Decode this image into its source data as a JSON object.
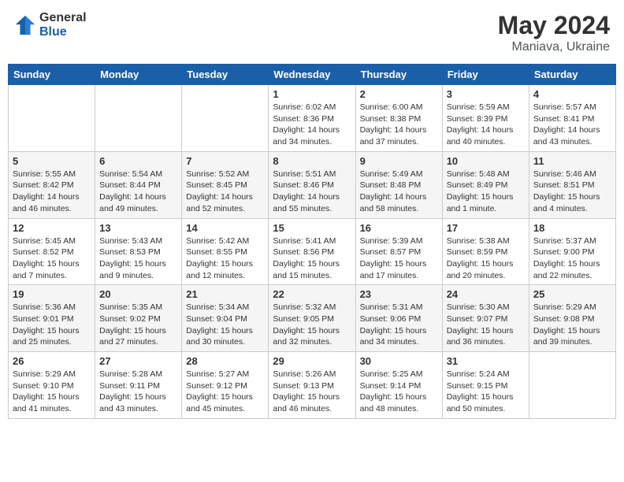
{
  "header": {
    "logo_general": "General",
    "logo_blue": "Blue",
    "month_year": "May 2024",
    "location": "Maniava, Ukraine"
  },
  "weekdays": [
    "Sunday",
    "Monday",
    "Tuesday",
    "Wednesday",
    "Thursday",
    "Friday",
    "Saturday"
  ],
  "weeks": [
    [
      {
        "day": "",
        "info": ""
      },
      {
        "day": "",
        "info": ""
      },
      {
        "day": "",
        "info": ""
      },
      {
        "day": "1",
        "info": "Sunrise: 6:02 AM\nSunset: 8:36 PM\nDaylight: 14 hours\nand 34 minutes."
      },
      {
        "day": "2",
        "info": "Sunrise: 6:00 AM\nSunset: 8:38 PM\nDaylight: 14 hours\nand 37 minutes."
      },
      {
        "day": "3",
        "info": "Sunrise: 5:59 AM\nSunset: 8:39 PM\nDaylight: 14 hours\nand 40 minutes."
      },
      {
        "day": "4",
        "info": "Sunrise: 5:57 AM\nSunset: 8:41 PM\nDaylight: 14 hours\nand 43 minutes."
      }
    ],
    [
      {
        "day": "5",
        "info": "Sunrise: 5:55 AM\nSunset: 8:42 PM\nDaylight: 14 hours\nand 46 minutes."
      },
      {
        "day": "6",
        "info": "Sunrise: 5:54 AM\nSunset: 8:44 PM\nDaylight: 14 hours\nand 49 minutes."
      },
      {
        "day": "7",
        "info": "Sunrise: 5:52 AM\nSunset: 8:45 PM\nDaylight: 14 hours\nand 52 minutes."
      },
      {
        "day": "8",
        "info": "Sunrise: 5:51 AM\nSunset: 8:46 PM\nDaylight: 14 hours\nand 55 minutes."
      },
      {
        "day": "9",
        "info": "Sunrise: 5:49 AM\nSunset: 8:48 PM\nDaylight: 14 hours\nand 58 minutes."
      },
      {
        "day": "10",
        "info": "Sunrise: 5:48 AM\nSunset: 8:49 PM\nDaylight: 15 hours\nand 1 minute."
      },
      {
        "day": "11",
        "info": "Sunrise: 5:46 AM\nSunset: 8:51 PM\nDaylight: 15 hours\nand 4 minutes."
      }
    ],
    [
      {
        "day": "12",
        "info": "Sunrise: 5:45 AM\nSunset: 8:52 PM\nDaylight: 15 hours\nand 7 minutes."
      },
      {
        "day": "13",
        "info": "Sunrise: 5:43 AM\nSunset: 8:53 PM\nDaylight: 15 hours\nand 9 minutes."
      },
      {
        "day": "14",
        "info": "Sunrise: 5:42 AM\nSunset: 8:55 PM\nDaylight: 15 hours\nand 12 minutes."
      },
      {
        "day": "15",
        "info": "Sunrise: 5:41 AM\nSunset: 8:56 PM\nDaylight: 15 hours\nand 15 minutes."
      },
      {
        "day": "16",
        "info": "Sunrise: 5:39 AM\nSunset: 8:57 PM\nDaylight: 15 hours\nand 17 minutes."
      },
      {
        "day": "17",
        "info": "Sunrise: 5:38 AM\nSunset: 8:59 PM\nDaylight: 15 hours\nand 20 minutes."
      },
      {
        "day": "18",
        "info": "Sunrise: 5:37 AM\nSunset: 9:00 PM\nDaylight: 15 hours\nand 22 minutes."
      }
    ],
    [
      {
        "day": "19",
        "info": "Sunrise: 5:36 AM\nSunset: 9:01 PM\nDaylight: 15 hours\nand 25 minutes."
      },
      {
        "day": "20",
        "info": "Sunrise: 5:35 AM\nSunset: 9:02 PM\nDaylight: 15 hours\nand 27 minutes."
      },
      {
        "day": "21",
        "info": "Sunrise: 5:34 AM\nSunset: 9:04 PM\nDaylight: 15 hours\nand 30 minutes."
      },
      {
        "day": "22",
        "info": "Sunrise: 5:32 AM\nSunset: 9:05 PM\nDaylight: 15 hours\nand 32 minutes."
      },
      {
        "day": "23",
        "info": "Sunrise: 5:31 AM\nSunset: 9:06 PM\nDaylight: 15 hours\nand 34 minutes."
      },
      {
        "day": "24",
        "info": "Sunrise: 5:30 AM\nSunset: 9:07 PM\nDaylight: 15 hours\nand 36 minutes."
      },
      {
        "day": "25",
        "info": "Sunrise: 5:29 AM\nSunset: 9:08 PM\nDaylight: 15 hours\nand 39 minutes."
      }
    ],
    [
      {
        "day": "26",
        "info": "Sunrise: 5:29 AM\nSunset: 9:10 PM\nDaylight: 15 hours\nand 41 minutes."
      },
      {
        "day": "27",
        "info": "Sunrise: 5:28 AM\nSunset: 9:11 PM\nDaylight: 15 hours\nand 43 minutes."
      },
      {
        "day": "28",
        "info": "Sunrise: 5:27 AM\nSunset: 9:12 PM\nDaylight: 15 hours\nand 45 minutes."
      },
      {
        "day": "29",
        "info": "Sunrise: 5:26 AM\nSunset: 9:13 PM\nDaylight: 15 hours\nand 46 minutes."
      },
      {
        "day": "30",
        "info": "Sunrise: 5:25 AM\nSunset: 9:14 PM\nDaylight: 15 hours\nand 48 minutes."
      },
      {
        "day": "31",
        "info": "Sunrise: 5:24 AM\nSunset: 9:15 PM\nDaylight: 15 hours\nand 50 minutes."
      },
      {
        "day": "",
        "info": ""
      }
    ]
  ]
}
